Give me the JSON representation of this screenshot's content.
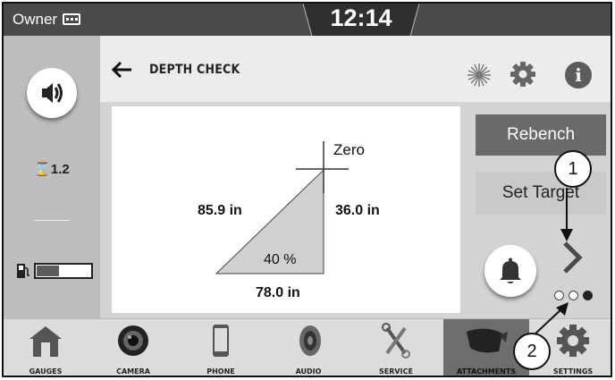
{
  "status_bar": {
    "owner_label": "Owner",
    "time": "12:14"
  },
  "left_panel": {
    "gauge_value": "⌛1.2",
    "fuel_level_fraction": 0.4
  },
  "header": {
    "title": "DEPTH CHECK"
  },
  "diagram": {
    "zero_label": "Zero",
    "hypotenuse_label": "85.9 in",
    "vertical_label": "36.0 in",
    "grade_label": "40 %",
    "base_label": "78.0 in"
  },
  "actions": {
    "rebench_label": "Rebench",
    "set_target_label": "Set Target"
  },
  "pagination": {
    "total_pages": 3,
    "active_page": 3
  },
  "bottom_nav": {
    "items": [
      {
        "label": "GAUGES",
        "icon": "home-icon"
      },
      {
        "label": "CAMERA",
        "icon": "camera-icon"
      },
      {
        "label": "PHONE",
        "icon": "phone-icon"
      },
      {
        "label": "AUDIO",
        "icon": "speaker-icon"
      },
      {
        "label": "SERVICE",
        "icon": "wrench-icon"
      },
      {
        "label": "ATTACHMENTS",
        "icon": "bucket-icon",
        "active": true
      },
      {
        "label": "SETTINGS",
        "icon": "gear-icon"
      }
    ]
  },
  "callouts": {
    "one": "1",
    "two": "2"
  },
  "colors": {
    "status_bar": "#4a4a4a",
    "rebench_bg": "#6a6a6a",
    "active_nav": "#6d6d6d"
  }
}
